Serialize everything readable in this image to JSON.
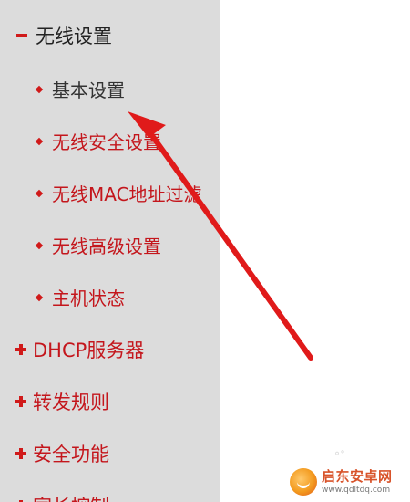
{
  "sidebar": {
    "items": [
      {
        "label": "无线设置",
        "icon": "minus-icon",
        "expanded": true
      },
      {
        "label": "基本设置",
        "icon": "bullet-icon",
        "active": true
      },
      {
        "label": "无线安全设置",
        "icon": "bullet-icon"
      },
      {
        "label": "无线MAC地址过滤",
        "icon": "bullet-icon"
      },
      {
        "label": "无线高级设置",
        "icon": "bullet-icon"
      },
      {
        "label": "主机状态",
        "icon": "bullet-icon"
      },
      {
        "label": "DHCP服务器",
        "icon": "plus-icon"
      },
      {
        "label": "转发规则",
        "icon": "plus-icon"
      },
      {
        "label": "安全功能",
        "icon": "plus-icon"
      },
      {
        "label": "家长控制",
        "icon": "plus-icon"
      }
    ]
  },
  "annotation": {
    "arrow_color": "#e01a1a",
    "points_to": "基本设置"
  },
  "watermark": {
    "name": "启东安卓网",
    "url": "www.qdltdq.com",
    "icon": "smile-logo-icon"
  },
  "colors": {
    "sidebar_bg": "#dcdcdc",
    "accent_red": "#c4161c",
    "active_text": "#333333"
  }
}
